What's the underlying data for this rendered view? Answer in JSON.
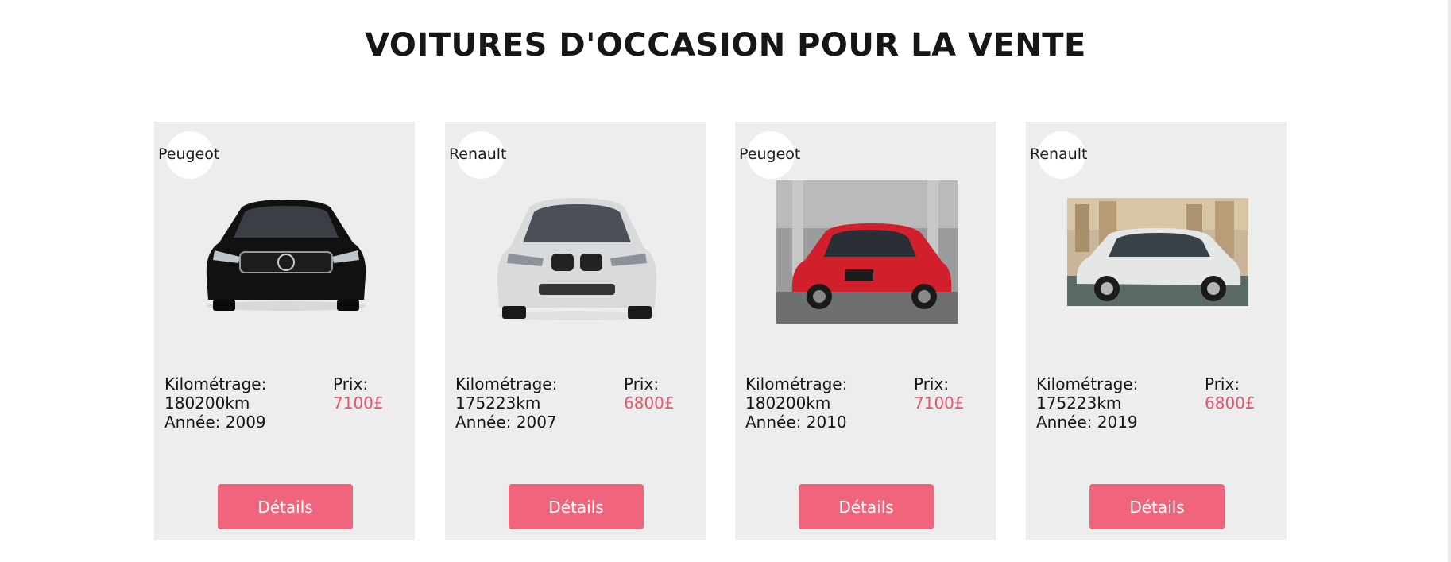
{
  "section": {
    "title": "VOITURES D'OCCASION POUR LA VENTE"
  },
  "cards": [
    {
      "brand": "Peugeot",
      "mileage_label": "Kilométrage:",
      "mileage": "180200km",
      "year_text": "Année: 2009",
      "price_label": "Prix:",
      "price": "7100£",
      "button": "Détails",
      "image": "black-mercedes-car"
    },
    {
      "brand": "Renault",
      "mileage_label": "Kilométrage:",
      "mileage": "175223km",
      "year_text": "Année: 2007",
      "price_label": "Prix:",
      "price": "6800£",
      "button": "Détails",
      "image": "white-bmw-suv"
    },
    {
      "brand": "Peugeot",
      "mileage_label": "Kilométrage:",
      "mileage": "180200km",
      "year_text": "Année: 2010",
      "price_label": "Prix:",
      "price": "7100£",
      "button": "Détails",
      "image": "red-nissan-hatchback"
    },
    {
      "brand": "Renault",
      "mileage_label": "Kilométrage:",
      "mileage": "175223km",
      "year_text": "Année: 2019",
      "price_label": "Prix:",
      "price": "6800£",
      "button": "Détails",
      "image": "white-citroen-suv"
    }
  ],
  "colors": {
    "card_background": "#ededed",
    "button": "#f0647c",
    "price": "#e25669",
    "title": "#161616"
  }
}
